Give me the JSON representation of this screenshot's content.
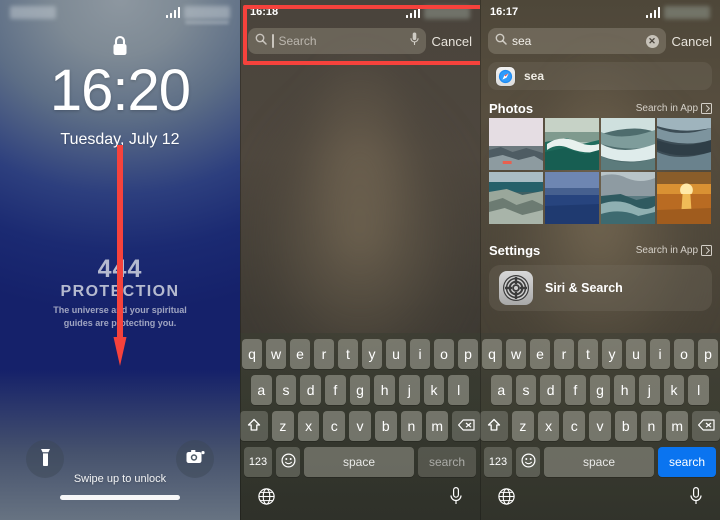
{
  "panel1": {
    "status": {
      "carrier_redacted": true,
      "signal_icon": "signal-bars-icon"
    },
    "lock_icon": "lock-icon",
    "time": "16:20",
    "date": "Tuesday, July 12",
    "widget": {
      "number": "444",
      "title": "PROTECTION",
      "subtitle": "The universe and your spiritual guides are protecting you."
    },
    "flashlight_icon": "flashlight-icon",
    "camera_icon": "camera-icon",
    "swipe_hint": "Swipe up to unlock",
    "annotation": {
      "arrow": "red-down-arrow",
      "color": "#f6423c"
    }
  },
  "panel2": {
    "status": {
      "time": "16:18",
      "carrier_redacted": true
    },
    "search": {
      "icon": "search-icon",
      "placeholder": "Search",
      "value": "",
      "mic_icon": "microphone-icon",
      "cancel_label": "Cancel"
    },
    "annotation": {
      "highlight": "red-rectangle",
      "color": "#f6423c"
    },
    "keyboard": {
      "row1": [
        "q",
        "w",
        "e",
        "r",
        "t",
        "y",
        "u",
        "i",
        "o",
        "p"
      ],
      "row2": [
        "a",
        "s",
        "d",
        "f",
        "g",
        "h",
        "j",
        "k",
        "l"
      ],
      "row3": [
        "z",
        "x",
        "c",
        "v",
        "b",
        "n",
        "m"
      ],
      "shift_icon": "shift-icon",
      "backspace_icon": "backspace-icon",
      "numbers_label": "123",
      "emoji_icon": "emoji-icon",
      "space_label": "space",
      "go_label": "search",
      "go_active": false,
      "globe_icon": "globe-icon",
      "dictation_icon": "microphone-icon"
    }
  },
  "panel3": {
    "status": {
      "time": "16:17",
      "carrier_redacted": true
    },
    "search": {
      "icon": "search-icon",
      "value": "sea",
      "clear_icon": "clear-icon",
      "cancel_label": "Cancel"
    },
    "suggestion": {
      "icon": "safari-icon",
      "label": "sea"
    },
    "photos_section": {
      "title": "Photos",
      "link_label": "Search in App",
      "link_icon": "open-in-app-icon",
      "thumbnails": [
        "pale-sky-over-rocky-shore",
        "iceberg-and-turquoise-wave",
        "white-foamy-surf",
        "dark-sea-with-clouds",
        "rocky-coast-green-water",
        "deep-blue-calm-ocean",
        "storm-clouds-over-waves",
        "orange-sunset-over-sea"
      ]
    },
    "settings_section": {
      "title": "Settings",
      "link_label": "Search in App",
      "link_icon": "open-in-app-icon",
      "item": {
        "icon": "gear-icon",
        "label": "Siri & Search"
      }
    },
    "keyboard": {
      "row1": [
        "q",
        "w",
        "e",
        "r",
        "t",
        "y",
        "u",
        "i",
        "o",
        "p"
      ],
      "row2": [
        "a",
        "s",
        "d",
        "f",
        "g",
        "h",
        "j",
        "k",
        "l"
      ],
      "row3": [
        "z",
        "x",
        "c",
        "v",
        "b",
        "n",
        "m"
      ],
      "shift_icon": "shift-icon",
      "backspace_icon": "backspace-icon",
      "numbers_label": "123",
      "emoji_icon": "emoji-icon",
      "space_label": "space",
      "go_label": "search",
      "go_active": true,
      "go_color": "#0a74f0",
      "globe_icon": "globe-icon",
      "dictation_icon": "microphone-icon"
    }
  }
}
